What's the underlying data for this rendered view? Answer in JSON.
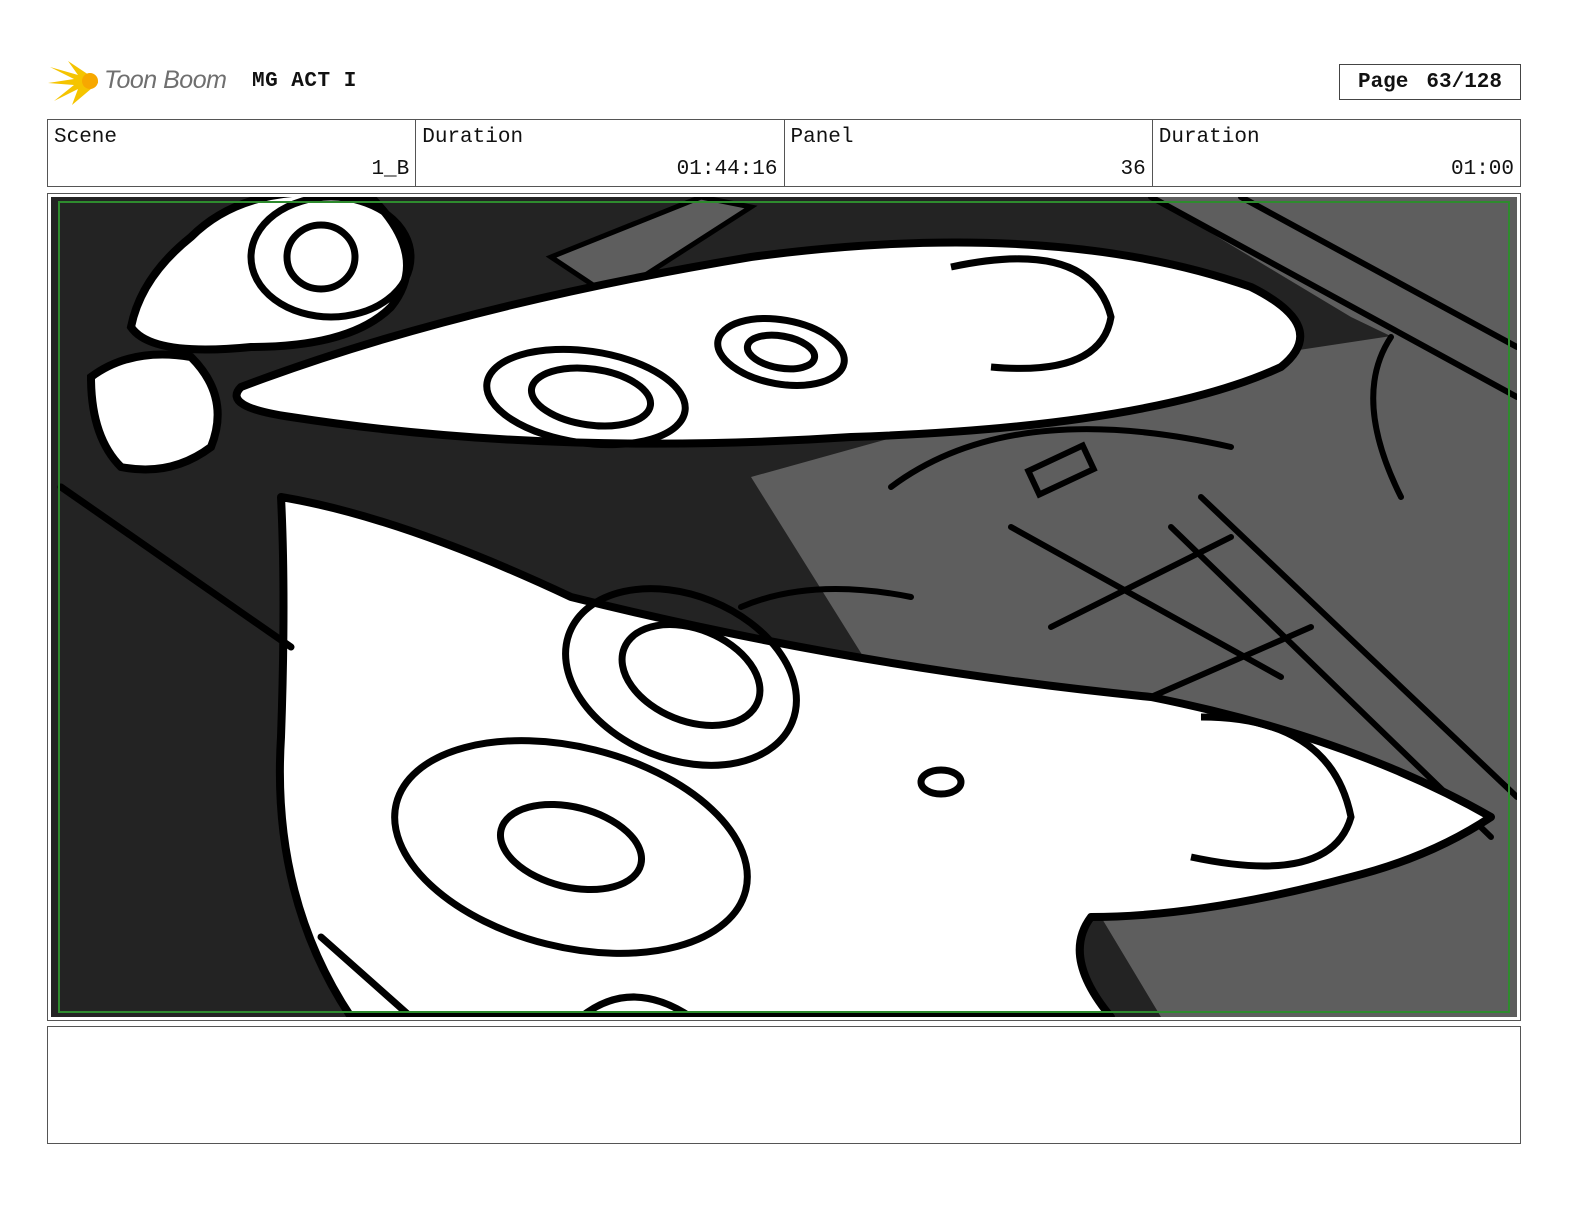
{
  "header": {
    "brand": "Toon Boom",
    "project_title": "MG ACT I",
    "page_label": "Page",
    "page_value": "63/128"
  },
  "info": {
    "scene_label": "Scene",
    "scene_value": "1_B",
    "scene_duration_label": "Duration",
    "scene_duration_value": "01:44:16",
    "panel_label": "Panel",
    "panel_value": "36",
    "panel_duration_label": "Duration",
    "panel_duration_value": "01:00"
  },
  "notes": {
    "text": ""
  },
  "colors": {
    "logo_accent": "#f5c400",
    "panel_dark": "#232323",
    "panel_mid": "#5e5e5e",
    "safe_frame": "#2e8b2e"
  }
}
